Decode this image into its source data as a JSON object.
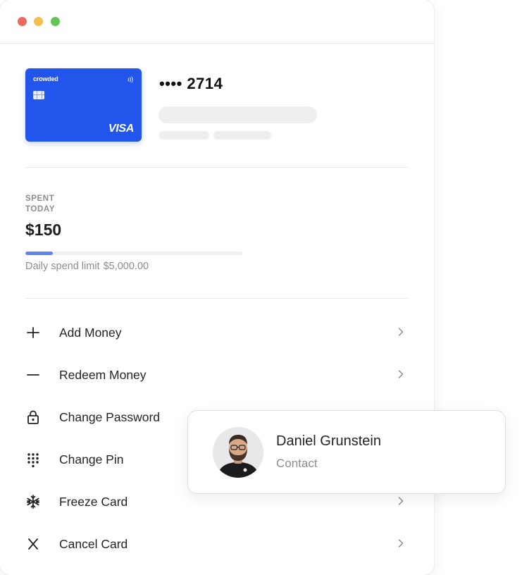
{
  "card": {
    "brand": "crowded",
    "network": "VISA",
    "number_masked": "•••• 2714",
    "color": "#2255ec"
  },
  "spending": {
    "label": "SPENT TODAY",
    "amount": "$150",
    "progress_fraction": 0.03,
    "limit_label": "Daily spend limit",
    "limit_value": "$5,000.00"
  },
  "actions": [
    {
      "label": "Add Money",
      "icon": "plus-icon"
    },
    {
      "label": "Redeem Money",
      "icon": "minus-icon"
    },
    {
      "label": "Change Password",
      "icon": "lock-icon"
    },
    {
      "label": "Change Pin",
      "icon": "keypad-icon"
    },
    {
      "label": "Freeze Card",
      "icon": "snowflake-icon"
    },
    {
      "label": "Cancel Card",
      "icon": "close-icon"
    }
  ],
  "contact": {
    "name": "Daniel Grunstein",
    "role": "Contact"
  },
  "colors": {
    "accent": "#2255ec",
    "progress": "#5d86ee",
    "window_red": "#ec6a5e",
    "window_yellow": "#f4bf4f",
    "window_green": "#61c554"
  }
}
